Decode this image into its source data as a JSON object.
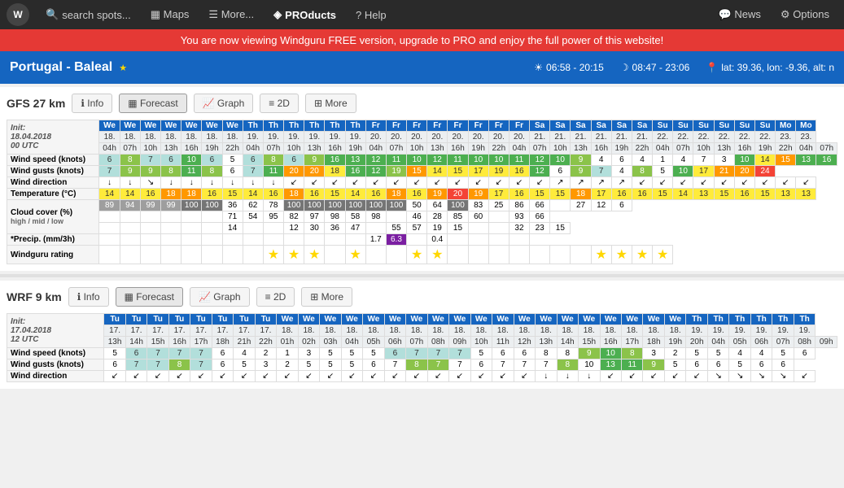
{
  "nav": {
    "logo": "W",
    "search_placeholder": "search spots...",
    "items": [
      {
        "label": "Maps",
        "icon": "▦"
      },
      {
        "label": "More...",
        "icon": "☰"
      },
      {
        "label": "PROducts",
        "icon": "◈"
      },
      {
        "label": "Help",
        "icon": "?"
      }
    ],
    "right_items": [
      {
        "label": "News",
        "icon": "💬"
      },
      {
        "label": "Options",
        "icon": "⚙"
      }
    ]
  },
  "alert": "You are now viewing Windguru FREE version, upgrade to PRO and enjoy the full power of this website!",
  "location": {
    "name": "Portugal - Baleal",
    "sunrise": "06:58 - 20:15",
    "moonrise": "08:47 - 23:06",
    "coords": "lat: 39.36, lon: -9.36, alt: n"
  },
  "section1": {
    "title": "GFS 27 km",
    "tabs": [
      "Info",
      "Forecast",
      "Graph",
      "2D",
      "More"
    ],
    "active_tab": "Forecast",
    "init_line1": "Init:",
    "init_line2": "18.04.2018",
    "init_line3": "00 UTC",
    "days_we": [
      "We",
      "We",
      "We",
      "We",
      "We",
      "We",
      "We"
    ],
    "days_th": [
      "Th",
      "Th",
      "Th",
      "Th",
      "Th",
      "Th"
    ],
    "rows": {
      "wind_speed_label": "Wind speed (knots)",
      "wind_gusts_label": "Wind gusts (knots)",
      "wind_dir_label": "Wind direction",
      "temp_label": "Temperature (°C)",
      "cloud_label": "Cloud cover (%)",
      "cloud_sub": "high / mid / low",
      "precip_label": "*Precip. (mm/3h)",
      "rating_label": "Windguru rating"
    }
  },
  "section2": {
    "title": "WRF 9 km",
    "tabs": [
      "Info",
      "Forecast",
      "Graph",
      "2D",
      "More"
    ],
    "active_tab": "Forecast",
    "init_line1": "Init:",
    "init_line2": "17.04.2018",
    "init_line3": "12 UTC",
    "rows": {
      "wind_speed_label": "Wind speed (knots)",
      "wind_gusts_label": "Wind gusts (knots)",
      "wind_dir_label": "Wind direction"
    }
  }
}
